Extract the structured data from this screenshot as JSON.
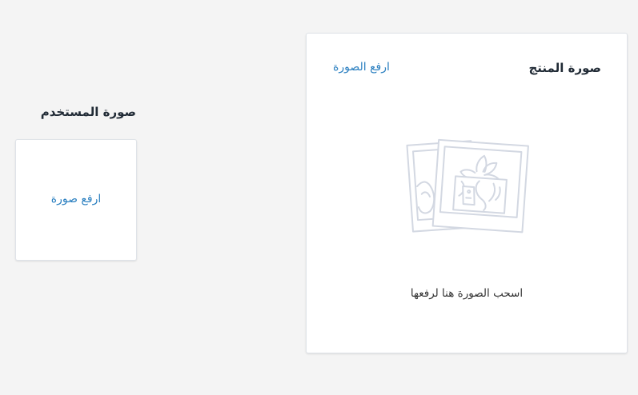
{
  "product_image": {
    "title": "صورة المنتج",
    "upload_link": "ارفع الصورة",
    "dropzone_hint": "اسحب الصورة هنا لرفعها",
    "illustration_icon": "photos-placeholder-icon"
  },
  "user_image": {
    "title": "صورة المستخدم",
    "upload_link": "ارفع صورة"
  },
  "colors": {
    "background": "#f4f4f4",
    "card": "#ffffff",
    "link": "#2a7fc0",
    "heading": "#212b36",
    "illustration": "#d3d8e2"
  }
}
